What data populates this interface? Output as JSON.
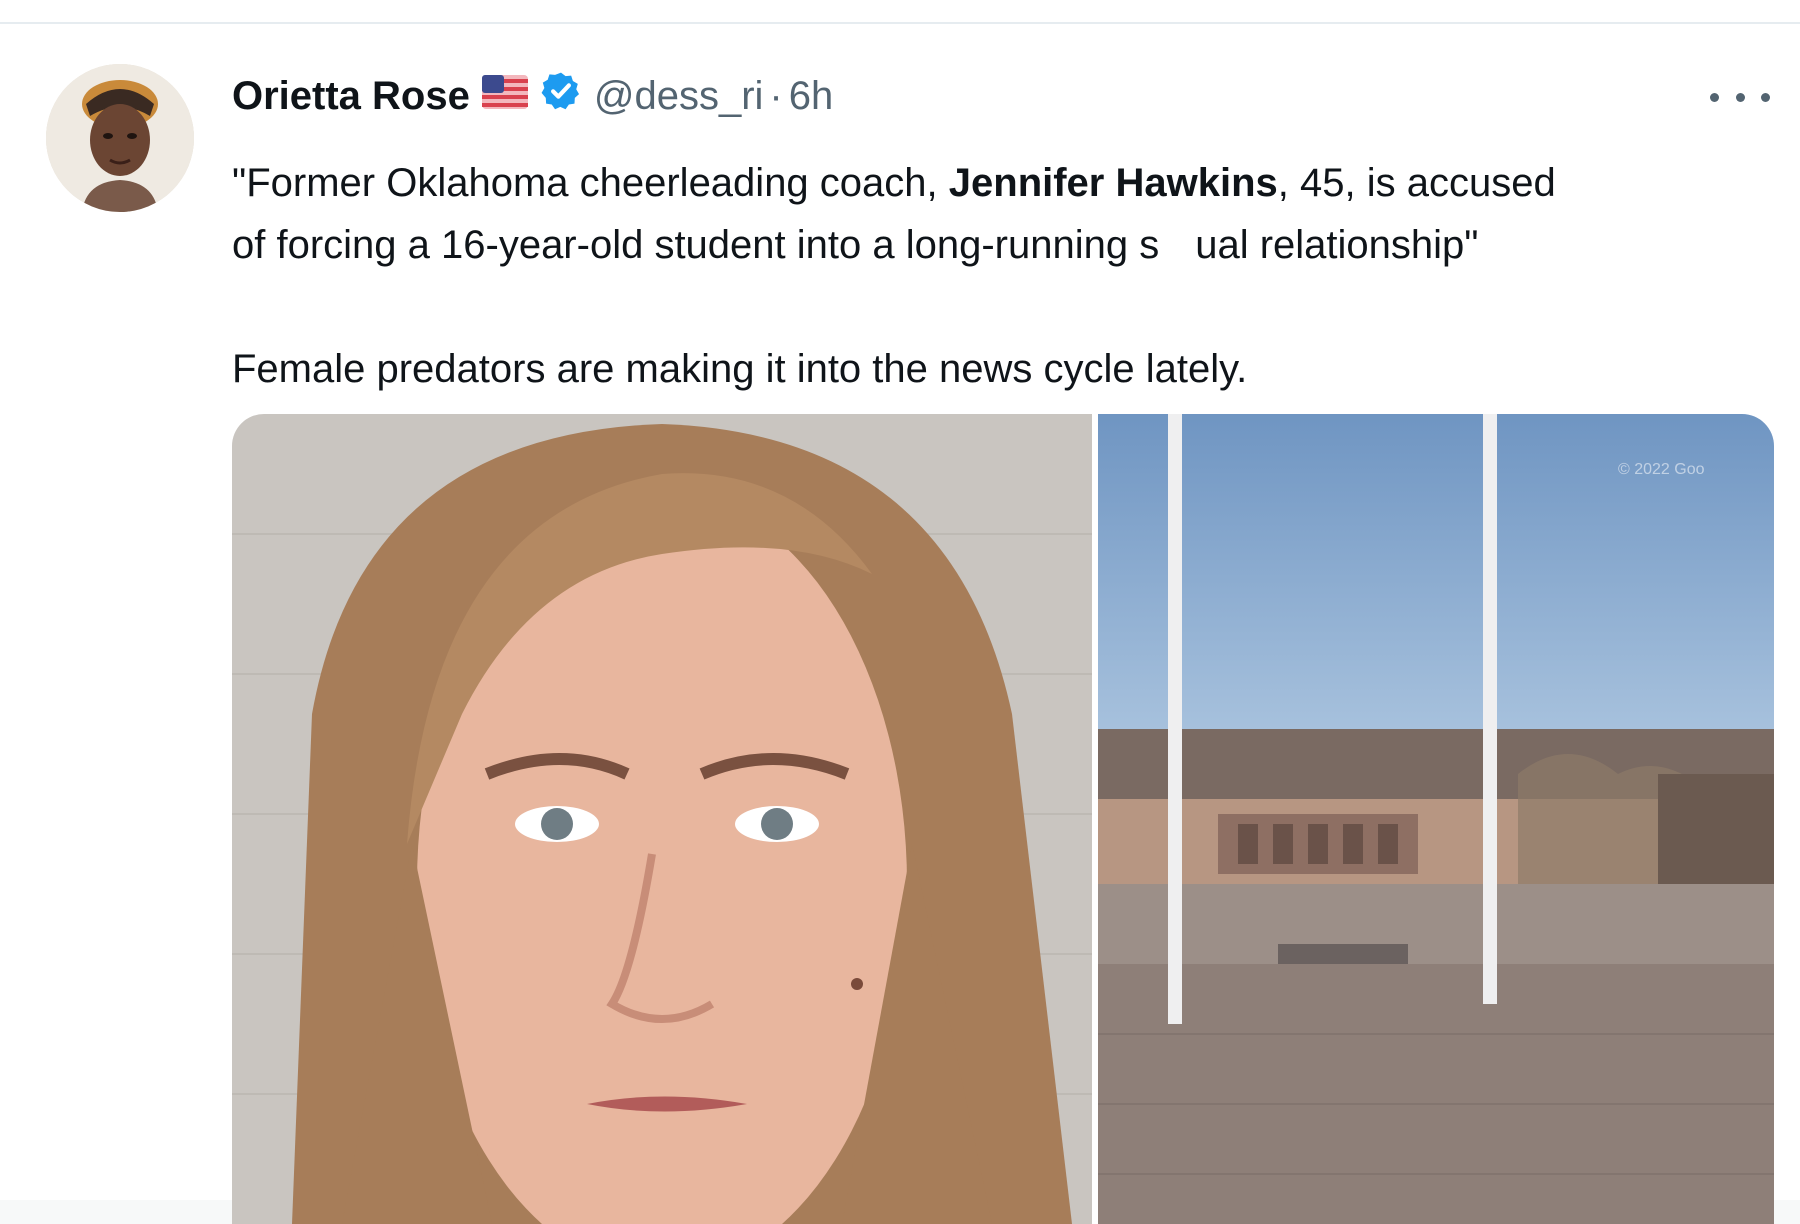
{
  "tweet": {
    "author_name": "Orietta Rose",
    "flag_icon": "us-flag-icon",
    "verified_icon": "verified-badge-icon",
    "handle": "@dess_ri",
    "separator": "·",
    "time": "6h",
    "more_icon": "more-options-icon",
    "text": {
      "line1_start": "\"Former Oklahoma cheerleading coach, ",
      "line1_bold": "Jennifer Hawkins",
      "line1_end": ", 45, is accused",
      "line2_start": "of forcing a 16-year-old student into a long-running s",
      "line2_end": "ual relationship\"",
      "paragraph2": "Female predators are making it into the news cycle lately."
    },
    "media": {
      "left_image": "mugshot-photo",
      "right_image": "school-building-photo",
      "right_watermark": "© 2022 Goo"
    }
  },
  "colors": {
    "text": "#0f1419",
    "secondary": "#536471",
    "verified": "#1d9bf0",
    "background": "#ffffff"
  }
}
